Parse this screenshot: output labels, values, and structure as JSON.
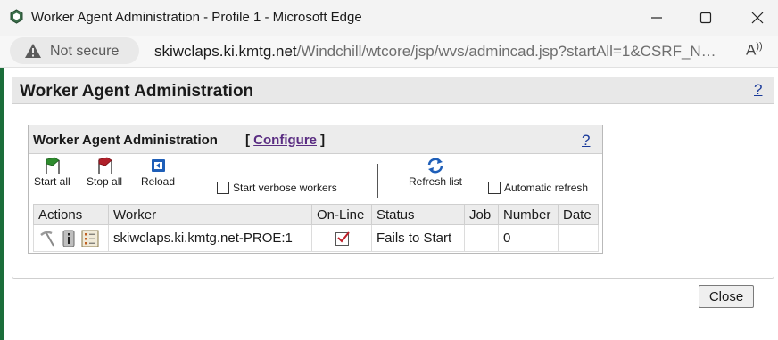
{
  "window": {
    "title": "Worker Agent Administration - Profile 1 - Microsoft Edge"
  },
  "address_bar": {
    "security_label": "Not secure",
    "url_host": "skiwclaps.ki.kmtg.net",
    "url_path": "/Windchill/wtcore/jsp/wvs/admincad.jsp?startAll=1&CSRF_N…"
  },
  "page": {
    "title": "Worker Agent Administration",
    "help_label": "?"
  },
  "panel": {
    "title": "Worker Agent Administration",
    "configure_open": "[ ",
    "configure_label": "Configure",
    "configure_close": " ]",
    "help_label": "?"
  },
  "toolbar": {
    "start_all": "Start all",
    "stop_all": "Stop all",
    "reload": "Reload",
    "verbose_label": "Start verbose workers",
    "verbose_checked": false,
    "refresh_list": "Refresh list",
    "auto_refresh_label": "Automatic refresh",
    "auto_refresh_checked": false
  },
  "table": {
    "columns": [
      "Actions",
      "Worker",
      "On-Line",
      "Status",
      "Job",
      "Number",
      "Date"
    ],
    "rows": [
      {
        "worker": "skiwclaps.ki.kmtg.net-PROE:1",
        "online": true,
        "status": "Fails to Start",
        "job": "",
        "number": "0",
        "date": ""
      }
    ]
  },
  "footer": {
    "close_label": "Close"
  },
  "colors": {
    "link": "#1a3a9a",
    "configure_link": "#5a2d82",
    "check_mark": "#c0202a",
    "start_flag": "#2e8b2e",
    "stop_flag": "#b0202a",
    "reload_icon": "#1f5fb8"
  }
}
